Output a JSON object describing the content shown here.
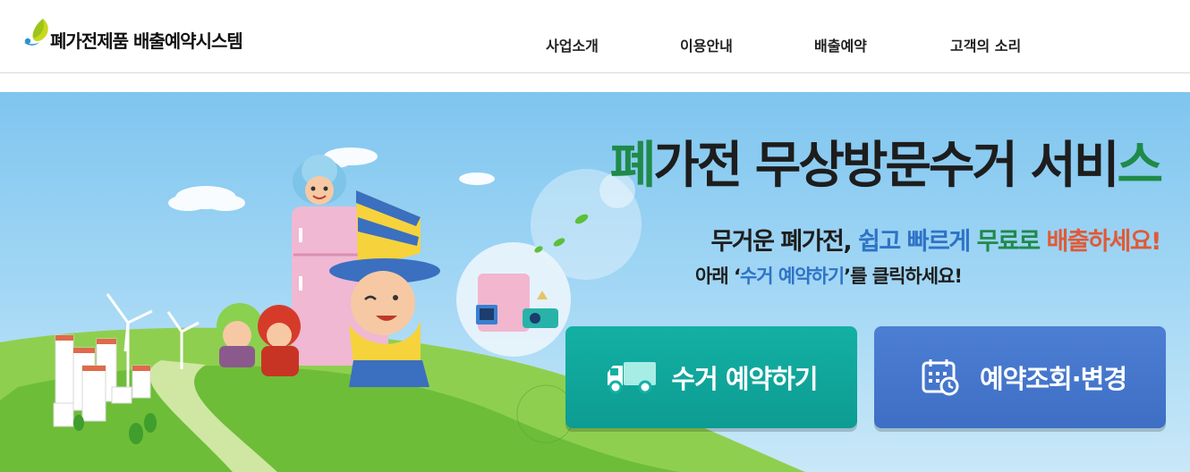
{
  "header": {
    "logo_title": "폐가전제품 배출예약시스템",
    "nav": [
      {
        "label": "사업소개"
      },
      {
        "label": "이용안내"
      },
      {
        "label": "배출예약"
      },
      {
        "label": "고객의 소리"
      }
    ]
  },
  "hero": {
    "title_part1": "폐",
    "title_part2": "가전 무상방문수거 서비",
    "title_part3": "스",
    "sub1_a": "무거운 폐가전, ",
    "sub1_b": "쉽고 빠르게 ",
    "sub1_c": "무료로 ",
    "sub1_d": "배출하세요!",
    "sub2_a": "아래 ‘",
    "sub2_b": "수거 예약하기",
    "sub2_c": "’를 클릭하세요!",
    "reserve_button": "수거 예약하기",
    "lookup_button": "예약조회·변경"
  },
  "colors": {
    "accent_green": "#1f8a4a",
    "accent_blue": "#2f73c6",
    "accent_red": "#e05a37",
    "reserve_button_bg": "#11a89d",
    "lookup_button_bg": "#4677cc",
    "sky": "#8ecdf1"
  },
  "icons": {
    "logo": "leaf-drop-logo-icon",
    "reserve": "truck-icon",
    "lookup": "calendar-clock-icon"
  }
}
